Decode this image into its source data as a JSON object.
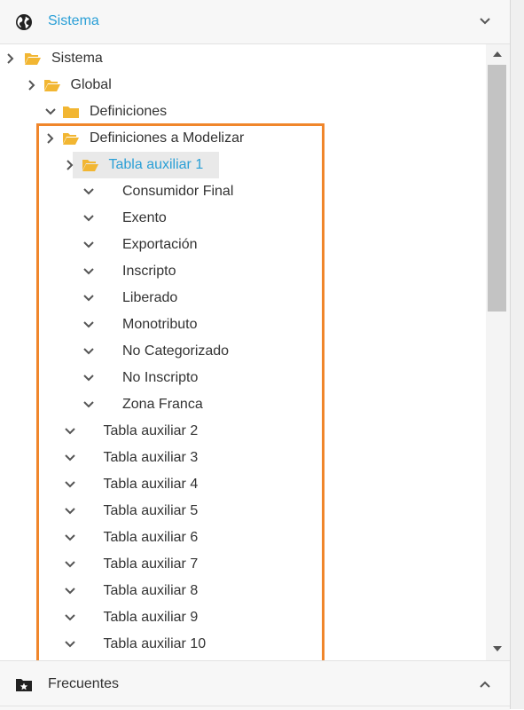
{
  "header": {
    "title": "Sistema",
    "icon": "globe-icon"
  },
  "tree": [
    {
      "label": "Sistema",
      "chevron": "right",
      "folder": "open",
      "level": 0
    },
    {
      "label": "Global",
      "chevron": "right",
      "folder": "open",
      "level": 1
    },
    {
      "label": "Definiciones",
      "chevron": "down",
      "folder": "closed",
      "level": 2
    },
    {
      "label": "Definiciones a Modelizar",
      "chevron": "right",
      "folder": "open",
      "level": 2
    },
    {
      "label": "Tabla auxiliar 1",
      "chevron": "right",
      "folder": "open",
      "level": 3,
      "selected": true
    },
    {
      "label": "Consumidor Final",
      "chevron": "down",
      "folder": "none",
      "level": 4
    },
    {
      "label": "Exento",
      "chevron": "down",
      "folder": "none",
      "level": 4
    },
    {
      "label": "Exportación",
      "chevron": "down",
      "folder": "none",
      "level": 4
    },
    {
      "label": "Inscripto",
      "chevron": "down",
      "folder": "none",
      "level": 4
    },
    {
      "label": "Liberado",
      "chevron": "down",
      "folder": "none",
      "level": 4
    },
    {
      "label": "Monotributo",
      "chevron": "down",
      "folder": "none",
      "level": 4
    },
    {
      "label": "No Categorizado",
      "chevron": "down",
      "folder": "none",
      "level": 4
    },
    {
      "label": "No Inscripto",
      "chevron": "down",
      "folder": "none",
      "level": 4
    },
    {
      "label": "Zona Franca",
      "chevron": "down",
      "folder": "none",
      "level": 4
    },
    {
      "label": "Tabla auxiliar 2",
      "chevron": "down",
      "folder": "none",
      "level": 3
    },
    {
      "label": "Tabla auxiliar 3",
      "chevron": "down",
      "folder": "none",
      "level": 3
    },
    {
      "label": "Tabla auxiliar 4",
      "chevron": "down",
      "folder": "none",
      "level": 3
    },
    {
      "label": "Tabla auxiliar 5",
      "chevron": "down",
      "folder": "none",
      "level": 3
    },
    {
      "label": "Tabla auxiliar 6",
      "chevron": "down",
      "folder": "none",
      "level": 3
    },
    {
      "label": "Tabla auxiliar 7",
      "chevron": "down",
      "folder": "none",
      "level": 3
    },
    {
      "label": "Tabla auxiliar 8",
      "chevron": "down",
      "folder": "none",
      "level": 3
    },
    {
      "label": "Tabla auxiliar 9",
      "chevron": "down",
      "folder": "none",
      "level": 3
    },
    {
      "label": "Tabla auxiliar 10",
      "chevron": "down",
      "folder": "none",
      "level": 3
    }
  ],
  "footer": {
    "title": "Frecuentes",
    "icon": "star-folder-icon"
  },
  "colors": {
    "accent": "#2a9fd6",
    "folder": "#f2b632",
    "highlight": "#f0862b",
    "text": "#333333"
  }
}
